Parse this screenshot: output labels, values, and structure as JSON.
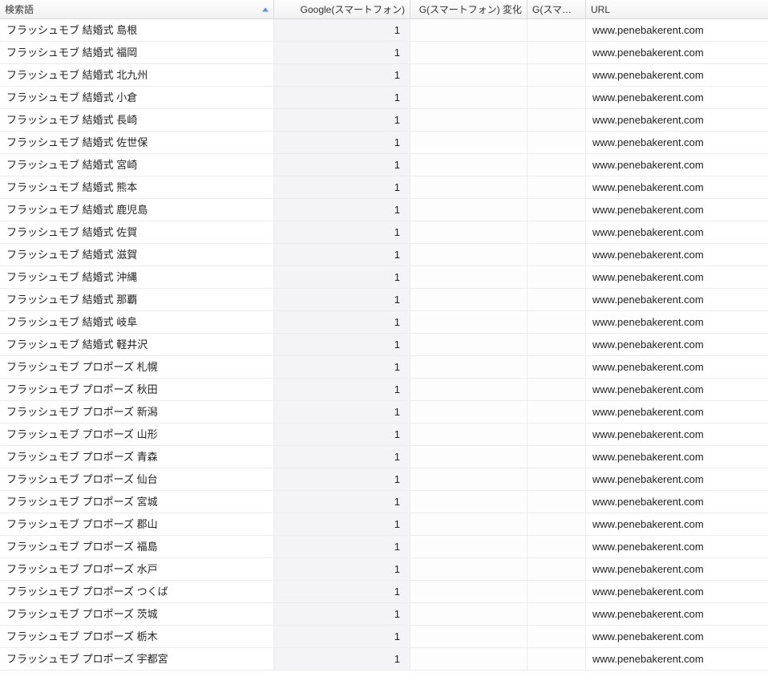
{
  "columns": [
    {
      "label": "検索語",
      "sortAsc": true
    },
    {
      "label": "Google(スマートフォン)"
    },
    {
      "label": "G(スマートフォン) 変化"
    },
    {
      "label": "G(スマートフ..."
    },
    {
      "label": "URL"
    }
  ],
  "rows": [
    {
      "term": "フラッシュモブ 結婚式 島根",
      "rank": "1",
      "url": "www.penebakerent.com"
    },
    {
      "term": "フラッシュモブ 結婚式 福岡",
      "rank": "1",
      "url": "www.penebakerent.com"
    },
    {
      "term": "フラッシュモブ 結婚式 北九州",
      "rank": "1",
      "url": "www.penebakerent.com"
    },
    {
      "term": "フラッシュモブ 結婚式 小倉",
      "rank": "1",
      "url": "www.penebakerent.com"
    },
    {
      "term": "フラッシュモブ 結婚式 長崎",
      "rank": "1",
      "url": "www.penebakerent.com"
    },
    {
      "term": "フラッシュモブ 結婚式 佐世保",
      "rank": "1",
      "url": "www.penebakerent.com"
    },
    {
      "term": "フラッシュモブ 結婚式 宮崎",
      "rank": "1",
      "url": "www.penebakerent.com"
    },
    {
      "term": "フラッシュモブ 結婚式 熊本",
      "rank": "1",
      "url": "www.penebakerent.com"
    },
    {
      "term": "フラッシュモブ 結婚式 鹿児島",
      "rank": "1",
      "url": "www.penebakerent.com"
    },
    {
      "term": "フラッシュモブ 結婚式 佐賀",
      "rank": "1",
      "url": "www.penebakerent.com"
    },
    {
      "term": "フラッシュモブ 結婚式 滋賀",
      "rank": "1",
      "url": "www.penebakerent.com"
    },
    {
      "term": "フラッシュモブ 結婚式 沖縄",
      "rank": "1",
      "url": "www.penebakerent.com"
    },
    {
      "term": "フラッシュモブ 結婚式 那覇",
      "rank": "1",
      "url": "www.penebakerent.com"
    },
    {
      "term": "フラッシュモブ 結婚式 岐阜",
      "rank": "1",
      "url": "www.penebakerent.com"
    },
    {
      "term": "フラッシュモブ 結婚式 軽井沢",
      "rank": "1",
      "url": "www.penebakerent.com"
    },
    {
      "term": "フラッシュモブ プロポーズ 札幌",
      "rank": "1",
      "url": "www.penebakerent.com"
    },
    {
      "term": "フラッシュモブ プロポーズ 秋田",
      "rank": "1",
      "url": "www.penebakerent.com"
    },
    {
      "term": "フラッシュモブ プロポーズ 新潟",
      "rank": "1",
      "url": "www.penebakerent.com"
    },
    {
      "term": "フラッシュモブ プロポーズ 山形",
      "rank": "1",
      "url": "www.penebakerent.com"
    },
    {
      "term": "フラッシュモブ プロポーズ 青森",
      "rank": "1",
      "url": "www.penebakerent.com"
    },
    {
      "term": "フラッシュモブ プロポーズ 仙台",
      "rank": "1",
      "url": "www.penebakerent.com"
    },
    {
      "term": "フラッシュモブ プロポーズ 宮城",
      "rank": "1",
      "url": "www.penebakerent.com"
    },
    {
      "term": "フラッシュモブ プロポーズ 郡山",
      "rank": "1",
      "url": "www.penebakerent.com"
    },
    {
      "term": "フラッシュモブ プロポーズ 福島",
      "rank": "1",
      "url": "www.penebakerent.com"
    },
    {
      "term": "フラッシュモブ プロポーズ 水戸",
      "rank": "1",
      "url": "www.penebakerent.com"
    },
    {
      "term": "フラッシュモブ プロポーズ つくば",
      "rank": "1",
      "url": "www.penebakerent.com"
    },
    {
      "term": "フラッシュモブ プロポーズ 茨城",
      "rank": "1",
      "url": "www.penebakerent.com"
    },
    {
      "term": "フラッシュモブ プロポーズ 栃木",
      "rank": "1",
      "url": "www.penebakerent.com"
    },
    {
      "term": "フラッシュモブ プロポーズ 宇都宮",
      "rank": "1",
      "url": "www.penebakerent.com"
    }
  ]
}
